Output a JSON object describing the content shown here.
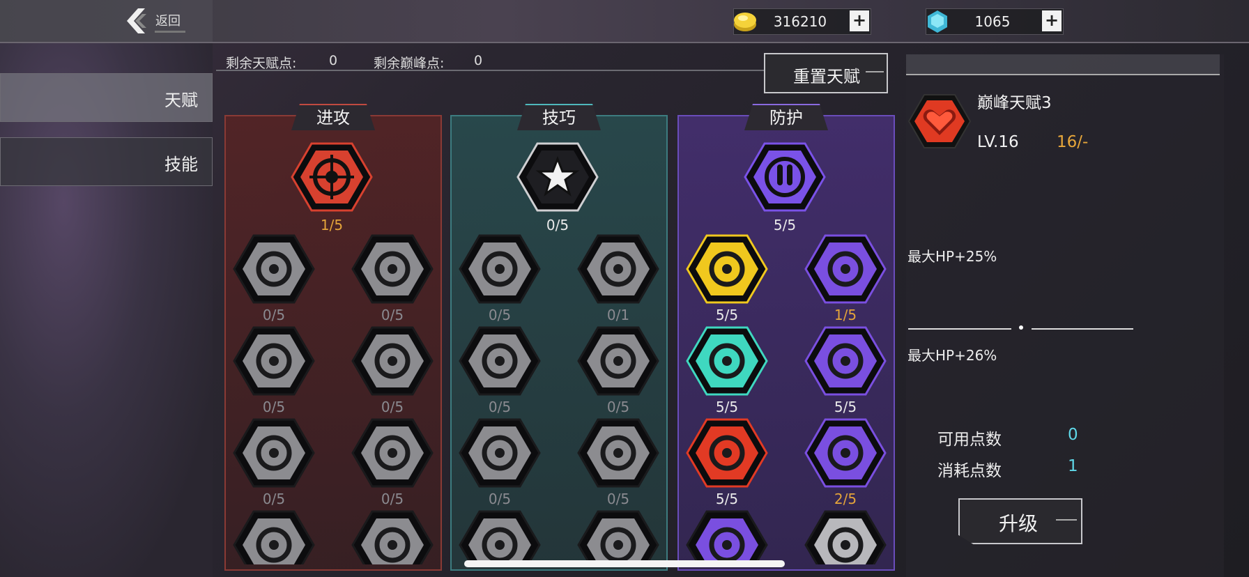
{
  "header": {
    "back_label": "返回",
    "gold_value": "316210",
    "gem_value": "1065",
    "plus_label": "+"
  },
  "sidebar": {
    "tabs": [
      {
        "label": "天赋",
        "active": true
      },
      {
        "label": "技能",
        "active": false
      }
    ]
  },
  "points": {
    "talent_label": "剩余天赋点:",
    "talent_value": "0",
    "peak_label": "剩余巅峰点:",
    "peak_value": "0",
    "reset_label": "重置天赋"
  },
  "columns": [
    {
      "title": "进攻",
      "color": "#d8412f",
      "top": {
        "level": "1/5",
        "icon": "crosshair-target-icon"
      },
      "rows": [
        [
          {
            "level": "0/5",
            "icon": "arrow-right-icon"
          },
          {
            "level": "0/5",
            "icon": "skull-helmet-icon"
          }
        ],
        [
          {
            "level": "0/5",
            "icon": "scope-icon"
          },
          {
            "level": "0/5",
            "icon": "swirl-icon"
          }
        ],
        [
          {
            "level": "0/5",
            "icon": "gear-bullet-icon"
          },
          {
            "level": "0/5",
            "icon": "slash-blades-icon"
          }
        ],
        [
          {
            "level": "",
            "icon": "bullet-icon"
          },
          {
            "level": "",
            "icon": "wheel-icon"
          }
        ]
      ]
    },
    {
      "title": "技巧",
      "color": "#4fb8bc",
      "top": {
        "level": "0/5",
        "icon": "star-icon"
      },
      "rows": [
        [
          {
            "level": "0/5",
            "icon": "lightning-cycle-icon"
          },
          {
            "level": "0/1",
            "icon": "dash-boot-icon"
          }
        ],
        [
          {
            "level": "0/5",
            "icon": "battery-refresh-icon"
          },
          {
            "level": "0/5",
            "icon": "turret-icon"
          }
        ],
        [
          {
            "level": "0/5",
            "icon": "saw-blade-icon"
          },
          {
            "level": "0/5",
            "icon": "twin-turret-icon"
          }
        ],
        [
          {
            "level": "",
            "icon": "gears-icon"
          },
          {
            "level": "",
            "icon": "turret-cycle-icon"
          }
        ]
      ]
    },
    {
      "title": "防护",
      "color": "#7a52e8",
      "top": {
        "level": "5/5",
        "icon": "missile-return-icon"
      },
      "rows": [
        [
          {
            "level": "5/5",
            "icon": "missiles-icon"
          },
          {
            "level": "1/5",
            "icon": "shield-swirl-icon"
          }
        ],
        [
          {
            "level": "5/5",
            "icon": "energy-bolt-icon"
          },
          {
            "level": "5/5",
            "icon": "shield-missile-icon"
          }
        ],
        [
          {
            "level": "5/5",
            "icon": "heart-cross-icon"
          },
          {
            "level": "2/5",
            "icon": "shield-skull-icon"
          }
        ],
        [
          {
            "level": "",
            "icon": "shield-v-icon"
          },
          {
            "level": "",
            "icon": "armor-icon"
          }
        ]
      ]
    }
  ],
  "detail": {
    "name": "巅峰天赋3",
    "level": "LV.16",
    "count": "16/-",
    "effect_current": "最大HP+25%",
    "effect_next": "最大HP+26%",
    "available_label": "可用点数",
    "available_value": "0",
    "cost_label": "消耗点数",
    "cost_value": "1",
    "upgrade_label": "升级"
  }
}
